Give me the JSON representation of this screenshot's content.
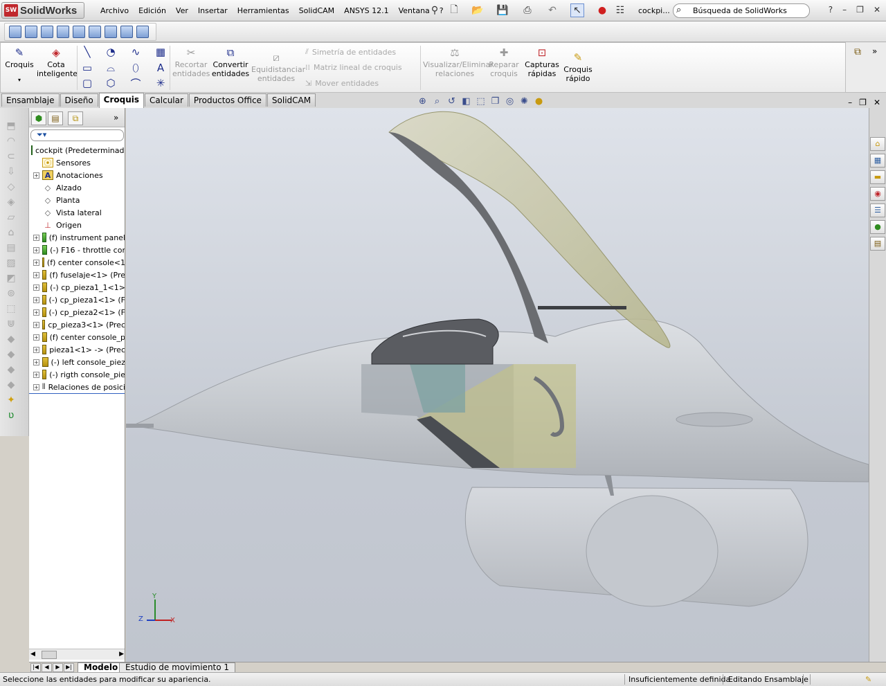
{
  "app": {
    "name": "SolidWorks",
    "badge": "SW",
    "doc_title": "cockpi..."
  },
  "menu": [
    "Archivo",
    "Edición",
    "Ver",
    "Insertar",
    "Herramientas",
    "SolidCAM",
    "ANSYS 12.1",
    "Ventana",
    "?"
  ],
  "search": {
    "placeholder": "Búsqueda de SolidWorks"
  },
  "help_label": "?",
  "commands": {
    "croquis": "Croquis",
    "cota_l1": "Cota",
    "cota_l2": "inteligente",
    "recortar_l1": "Recortar",
    "recortar_l2": "entidades",
    "convertir_l1": "Convertir",
    "convertir_l2": "entidades",
    "equidistanciar_l1": "Equidistanciar",
    "equidistanciar_l2": "entidades",
    "simetria": "Simetría de entidades",
    "matriz": "Matriz lineal de croquis",
    "mover": "Mover entidades",
    "visualizar_l1": "Visualizar/Eliminar",
    "visualizar_l2": "relaciones",
    "reparar_l1": "Reparar",
    "reparar_l2": "croquis",
    "capturas_l1": "Capturas",
    "capturas_l2": "rápidas",
    "croquis_rapido_l1": "Croquis",
    "croquis_rapido_l2": "rápido"
  },
  "tabs": [
    "Ensamblaje",
    "Diseño",
    "Croquis",
    "Calcular",
    "Productos Office",
    "SolidCAM"
  ],
  "active_tab": "Croquis",
  "tree": {
    "root": "cockpit  (Predeterminado",
    "items": [
      {
        "label": "Sensores",
        "icon": "sensor-icon",
        "expand": false
      },
      {
        "label": "Anotaciones",
        "icon": "annotation-icon",
        "expand": true
      },
      {
        "label": "Alzado",
        "icon": "plane-icon",
        "expand": false
      },
      {
        "label": "Planta",
        "icon": "plane-icon",
        "expand": false
      },
      {
        "label": "Vista lateral",
        "icon": "plane-icon",
        "expand": false
      },
      {
        "label": "Origen",
        "icon": "origin-icon",
        "expand": false
      },
      {
        "label": "(f) instrument panel",
        "icon": "assembly-icon",
        "expand": true
      },
      {
        "label": "(-) F16 - throttle cor",
        "icon": "assembly-icon",
        "expand": true
      },
      {
        "label": "(f) center console<1",
        "icon": "part-icon",
        "expand": true
      },
      {
        "label": "(f) fuselaje<1> (Pre",
        "icon": "part-icon",
        "expand": true
      },
      {
        "label": "(-) cp_pieza1_1<1>",
        "icon": "part-icon",
        "expand": true
      },
      {
        "label": "(-) cp_pieza1<1> (F",
        "icon": "part-icon",
        "expand": true
      },
      {
        "label": "(-) cp_pieza2<1> (F",
        "icon": "part-icon",
        "expand": true
      },
      {
        "label": "cp_pieza3<1> (Prec",
        "icon": "part-icon",
        "expand": true
      },
      {
        "label": "(f) center console_p",
        "icon": "part-icon",
        "expand": true
      },
      {
        "label": "pieza1<1> -> (Prec",
        "icon": "part-icon",
        "expand": true
      },
      {
        "label": "(-) left console_piez",
        "icon": "part-icon",
        "expand": true
      },
      {
        "label": "(-) rigth console_pie",
        "icon": "part-icon",
        "expand": true
      },
      {
        "label": "Relaciones de posici",
        "icon": "mate-icon",
        "expand": true
      }
    ]
  },
  "bottom_tabs": [
    "Modelo",
    "Estudio de movimiento 1"
  ],
  "status": {
    "message": "Seleccione las entidades para modificar su apariencia.",
    "definition": "Insuficientemente definida",
    "mode": "Editando Ensamblaje"
  },
  "triad": {
    "x": "X",
    "y": "Y",
    "z": "Z"
  },
  "colors": {
    "accent": "#c0282d",
    "viewport_bg": "#d3d7de",
    "fuselage": "#bfc3c8",
    "canopy": "#c9c7a6"
  }
}
